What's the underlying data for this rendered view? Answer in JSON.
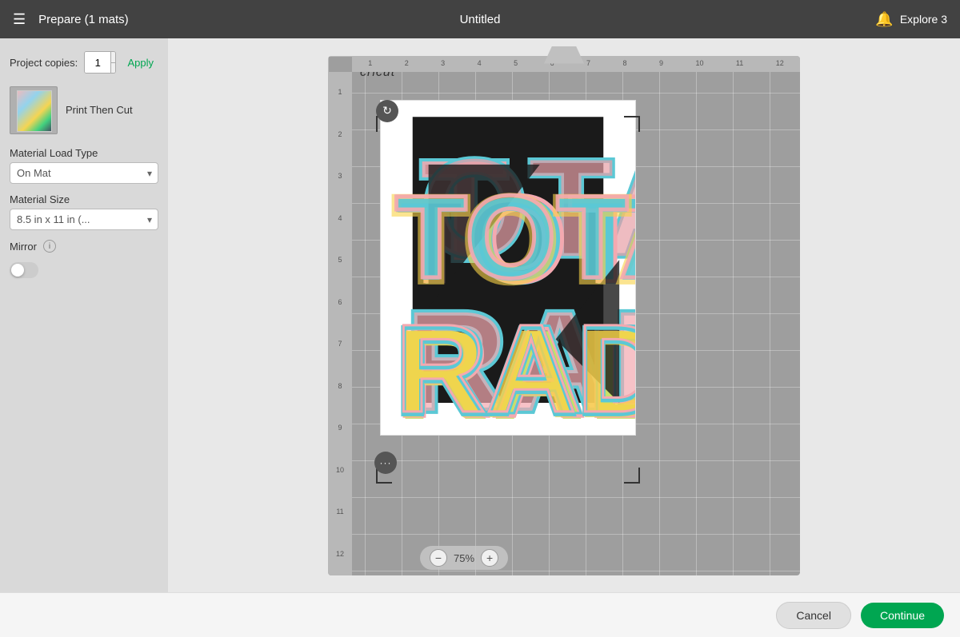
{
  "header": {
    "menu_label": "☰",
    "title": "Prepare (1 mats)",
    "center_title": "Untitled",
    "explore_label": "Explore 3"
  },
  "sidebar": {
    "project_copies_label": "Project copies:",
    "copies_value": "1",
    "apply_label": "Apply",
    "mat_label": "Print Then Cut",
    "material_load_label": "Material Load Type",
    "material_load_value": "On Mat",
    "material_size_label": "Material Size",
    "material_size_value": "8.5 in x 11 in (...",
    "mirror_label": "Mirror"
  },
  "canvas": {
    "cricut_logo": "cricut",
    "zoom_level": "75%",
    "zoom_in_label": "+",
    "zoom_out_label": "−"
  },
  "footer": {
    "cancel_label": "Cancel",
    "continue_label": "Continue"
  }
}
